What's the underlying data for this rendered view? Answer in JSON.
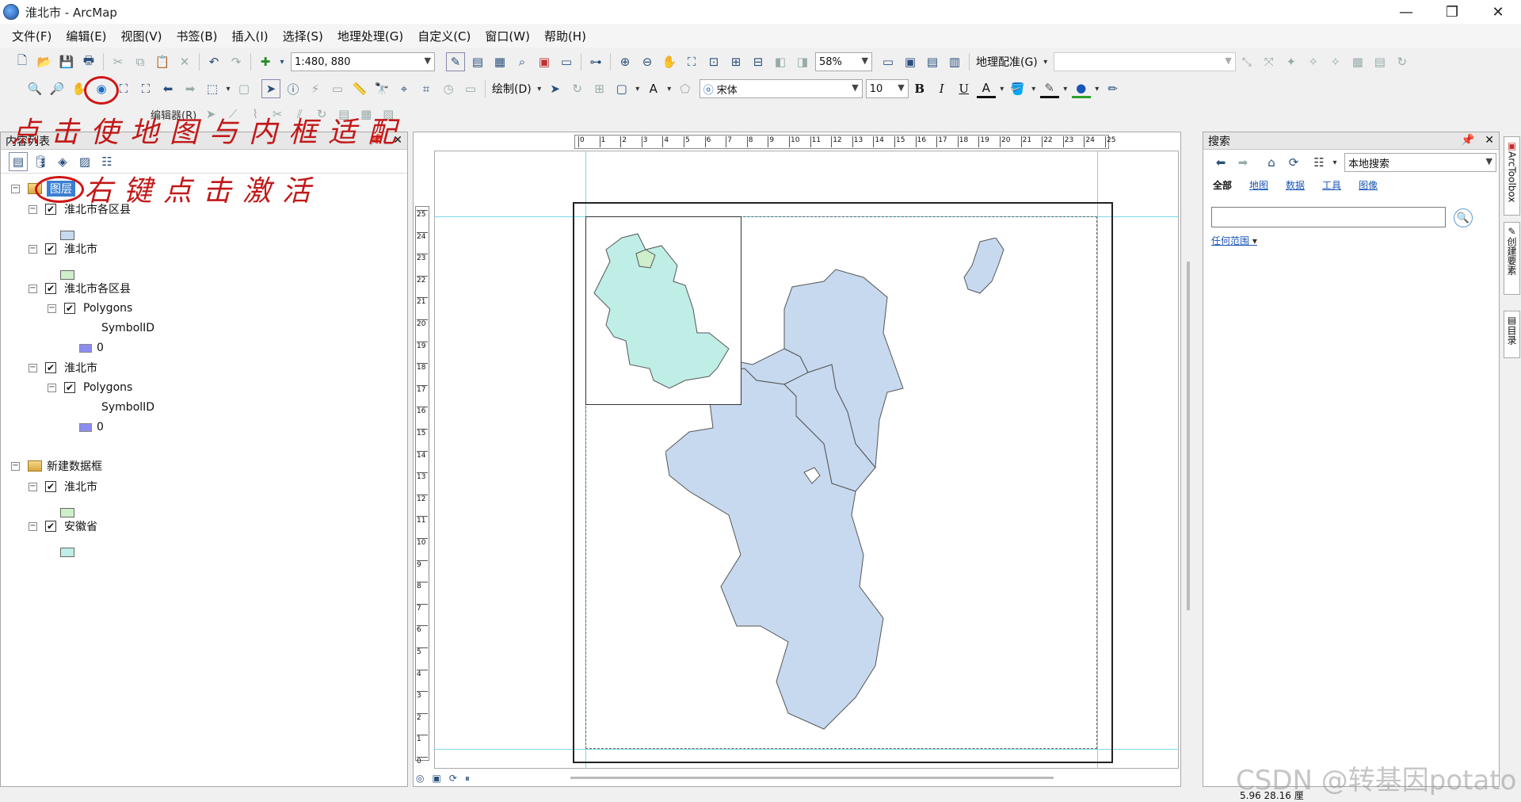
{
  "window": {
    "title": "淮北市 - ArcMap",
    "controls": [
      "—",
      "❐",
      "✕"
    ]
  },
  "menu": [
    "文件(F)",
    "编辑(E)",
    "视图(V)",
    "书签(B)",
    "插入(I)",
    "选择(S)",
    "地理处理(G)",
    "自定义(C)",
    "窗口(W)",
    "帮助(H)"
  ],
  "toolbar": {
    "scale": "1:480, 880",
    "zoom": "58%",
    "georef_label": "地理配准(G)",
    "draw_label": "绘制(D)",
    "font_name": "宋体",
    "font_size": "10",
    "bold": "B",
    "italic": "I",
    "underline": "U",
    "text_tool": "A",
    "editor_label": "编辑器(R)"
  },
  "toc": {
    "title": "内容列表",
    "rows": [
      {
        "label": "图层",
        "type": "frame",
        "highlight": true
      },
      {
        "label": "淮北市各区县",
        "type": "layer",
        "checked": true
      },
      {
        "label": "",
        "type": "swatch",
        "color": "#c6d9ef"
      },
      {
        "label": "淮北市",
        "type": "layer",
        "checked": true
      },
      {
        "label": "",
        "type": "swatch",
        "color": "#cfeecc"
      },
      {
        "label": "淮北市各区县",
        "type": "layer",
        "checked": true
      },
      {
        "label": "Polygons",
        "type": "sublayer",
        "checked": true
      },
      {
        "label": "SymbolID",
        "type": "field"
      },
      {
        "label": "0",
        "type": "value",
        "color": "#8c8cf0"
      },
      {
        "label": "淮北市",
        "type": "layer",
        "checked": true
      },
      {
        "label": "Polygons",
        "type": "sublayer",
        "checked": true
      },
      {
        "label": "SymbolID",
        "type": "field"
      },
      {
        "label": "0",
        "type": "value",
        "color": "#8c8cf0"
      },
      {
        "label": "新建数据框",
        "type": "frame",
        "highlight": false
      },
      {
        "label": "淮北市",
        "type": "layer",
        "checked": true
      },
      {
        "label": "",
        "type": "swatch",
        "color": "#cfeecc"
      },
      {
        "label": "安徽省",
        "type": "layer",
        "checked": true
      },
      {
        "label": "",
        "type": "swatch",
        "color": "#bfeee6"
      }
    ]
  },
  "ruler_h_ticks": [
    "0",
    "1",
    "2",
    "3",
    "4",
    "5",
    "6",
    "7",
    "8",
    "9",
    "10",
    "11",
    "12",
    "13",
    "14",
    "15",
    "16",
    "17",
    "18",
    "19",
    "20",
    "21",
    "22",
    "23",
    "24",
    "25"
  ],
  "ruler_v_ticks": [
    "25",
    "24",
    "23",
    "22",
    "21",
    "20",
    "19",
    "18",
    "17",
    "16",
    "15",
    "14",
    "13",
    "12",
    "11",
    "10",
    "9",
    "8",
    "7",
    "6",
    "5",
    "4",
    "3",
    "2",
    "1",
    "0"
  ],
  "search": {
    "title": "搜索",
    "scope_select": "本地搜索",
    "tabs": [
      "全部",
      "地图",
      "数据",
      "工具",
      "图像"
    ],
    "scope_link": "任何范围"
  },
  "side_tabs": [
    "ArcToolbox",
    "创建要素",
    "目录"
  ],
  "annotations": {
    "top": "点击使地图与内框适配",
    "layer": "右键点击激活",
    "color": "#c21818"
  },
  "status": {
    "coords": "5.96  28.16 厘"
  },
  "watermark": "CSDN @转基因potato",
  "map_colors": {
    "districts": "#c6d9ef",
    "anhui": "#bfeee6",
    "huaibei": "#cfeecc",
    "outline": "#555555"
  }
}
